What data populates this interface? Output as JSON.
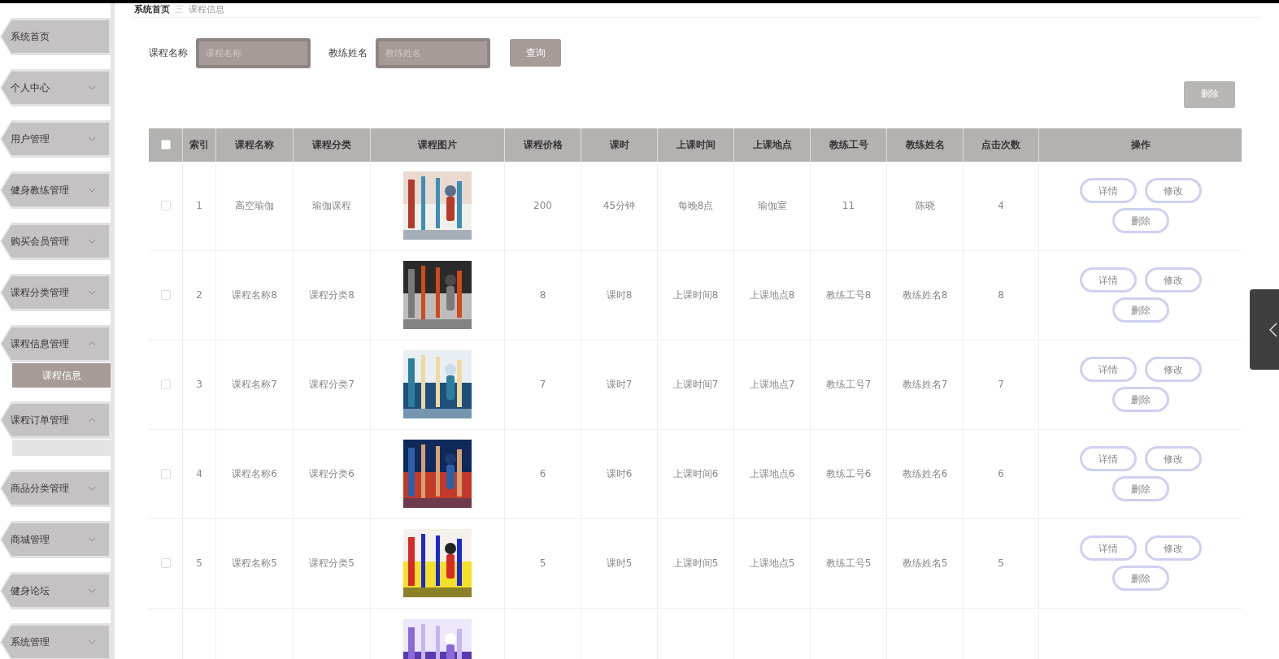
{
  "sidebar": {
    "items": [
      {
        "label": "系统首页",
        "kind": "link"
      },
      {
        "label": "个人中心",
        "kind": "menu",
        "expanded": false
      },
      {
        "label": "用户管理",
        "kind": "menu",
        "expanded": false
      },
      {
        "label": "健身教练管理",
        "kind": "menu",
        "expanded": false
      },
      {
        "label": "购买会员管理",
        "kind": "menu",
        "expanded": false
      },
      {
        "label": "课程分类管理",
        "kind": "menu",
        "expanded": false
      },
      {
        "label": "课程信息管理",
        "kind": "menu",
        "expanded": true,
        "children": [
          {
            "label": "课程信息",
            "selected": true
          }
        ]
      },
      {
        "label": "课程订单管理",
        "kind": "menu",
        "expanded": true
      },
      {
        "label": "商品分类管理",
        "kind": "menu",
        "expanded": false
      },
      {
        "label": "商城管理",
        "kind": "menu",
        "expanded": false
      },
      {
        "label": "健身论坛",
        "kind": "menu",
        "expanded": false
      },
      {
        "label": "系统管理",
        "kind": "menu",
        "expanded": false
      }
    ]
  },
  "breadcrumb": [
    "系统首页",
    "课程信息"
  ],
  "breadcrumb_separator": "三",
  "search": {
    "fields": [
      {
        "label": "课程名称",
        "placeholder": "课程名称"
      },
      {
        "label": "教练姓名",
        "placeholder": "教练姓名"
      }
    ],
    "button": "查询"
  },
  "delete_button": "删除",
  "table": {
    "select_all_checked": false,
    "columns": [
      "索引",
      "课程名称",
      "课程分类",
      "课程图片",
      "课程价格",
      "课时",
      "上课时间",
      "上课地点",
      "教练工号",
      "教练姓名",
      "点击次数",
      "操作"
    ],
    "rows": [
      {
        "kind": "full",
        "checked": false,
        "cells": [
          "1",
          "高空瑜伽",
          "瑜伽课程",
          "",
          "200",
          "45分钟",
          "每晚8点",
          "瑜伽室",
          "11",
          "陈晓",
          "4"
        ],
        "actions": [
          "详情",
          "修改",
          "删除"
        ]
      },
      {
        "kind": "full",
        "checked": false,
        "cells": [
          "2",
          "课程名称8",
          "课程分类8",
          "",
          "8",
          "课时8",
          "上课时间8",
          "上课地点8",
          "教练工号8",
          "教练姓名8",
          "8"
        ],
        "actions": [
          "详情",
          "修改",
          "删除"
        ]
      },
      {
        "kind": "full",
        "checked": false,
        "cells": [
          "3",
          "课程名称7",
          "课程分类7",
          "",
          "7",
          "课时7",
          "上课时间7",
          "上课地点7",
          "教练工号7",
          "教练姓名7",
          "7"
        ],
        "actions": [
          "详情",
          "修改",
          "删除"
        ]
      },
      {
        "kind": "full",
        "checked": false,
        "cells": [
          "4",
          "课程名称6",
          "课程分类6",
          "",
          "6",
          "课时6",
          "上课时间6",
          "上课地点6",
          "教练工号6",
          "教练姓名6",
          "6"
        ],
        "actions": [
          "详情",
          "修改",
          "删除"
        ]
      },
      {
        "kind": "full",
        "checked": false,
        "cells": [
          "5",
          "课程名称5",
          "课程分类5",
          "",
          "5",
          "课时5",
          "上课时间5",
          "上课地点5",
          "教练工号5",
          "教练姓名5",
          "5"
        ],
        "actions": [
          "详情",
          "修改",
          "删除"
        ]
      },
      {
        "kind": "partial"
      }
    ]
  }
}
